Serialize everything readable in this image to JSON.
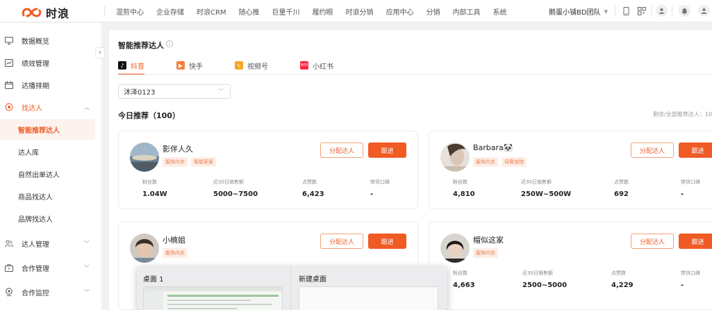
{
  "logo": {
    "text": "时浪",
    "brand_color": "#f05a24"
  },
  "topnav": {
    "items": [
      "混剪中心",
      "企业存储",
      "时浪CRM",
      "随心推",
      "巨量千川",
      "履约眼",
      "时浪分销",
      "应用中心",
      "分销",
      "内部工具",
      "系统"
    ],
    "team": "鹅蛋小铺BD团队"
  },
  "sidebar": {
    "items": [
      {
        "label": "数据概览",
        "icon": "monitor-icon"
      },
      {
        "label": "绩效管理",
        "icon": "chart-icon"
      },
      {
        "label": "达播排期",
        "icon": "calendar-icon"
      },
      {
        "label": "找达人",
        "icon": "target-icon"
      },
      {
        "label": "达人管理",
        "icon": "users-icon"
      },
      {
        "label": "合作管理",
        "icon": "briefcase-icon"
      },
      {
        "label": "合作监控",
        "icon": "monitor-watch-icon"
      }
    ],
    "sub_items": [
      "智能推荐达人",
      "达人库",
      "自然出单达人",
      "商品找达人",
      "品牌找达人"
    ]
  },
  "page": {
    "title": "智能推荐达人",
    "tabs": [
      "抖音",
      "快手",
      "视频号",
      "小红书"
    ],
    "select_value": "沐泽0123",
    "today_label": "今日推荐（100）",
    "remain_label": "剩余/全部推荐达人：10"
  },
  "labels": {
    "assign": "分配达人",
    "follow": "跟进",
    "fans": "粉丝数",
    "sales30": "近30日销售额",
    "likes": "点赞数",
    "mouth": "带货口碑"
  },
  "cards": [
    {
      "name": "影伴人久",
      "tags": [
        "服饰内衣",
        "智能家居"
      ],
      "fans": "1.04W",
      "sales": "5000~7500",
      "likes": "6,423",
      "mouth": "-"
    },
    {
      "name": "Barbara🐼",
      "tags": [
        "服饰内衣",
        "母婴宠物"
      ],
      "fans": "4,810",
      "sales": "250W~500W",
      "likes": "692",
      "mouth": "-"
    },
    {
      "name": "小楠姐",
      "tags": [
        "服饰内衣"
      ],
      "fans": "",
      "sales": "",
      "likes": "",
      "mouth": ""
    },
    {
      "name": "帽似这家",
      "tags": [
        "服饰内衣"
      ],
      "fans": "4,663",
      "sales": "2500~5000",
      "likes": "4,229",
      "mouth": "-"
    }
  ],
  "desktop_popup": {
    "desktop1": "桌面 1",
    "new_desktop": "新建桌面"
  }
}
